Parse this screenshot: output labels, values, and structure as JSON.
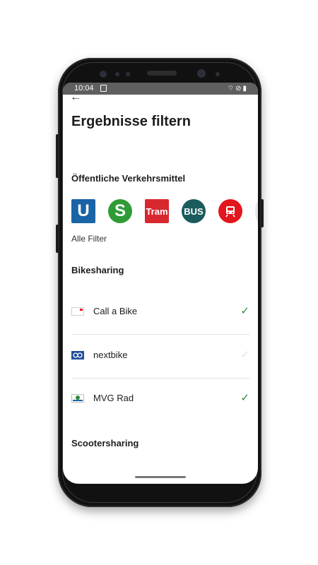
{
  "status": {
    "time": "10:04"
  },
  "page": {
    "title": "Ergebnisse filtern",
    "back_label": "←"
  },
  "transit": {
    "heading": "Öffentliche Verkehrsmittel",
    "items": [
      {
        "icon": "ubahn-icon",
        "label": "U"
      },
      {
        "icon": "sbahn-icon",
        "label": "S"
      },
      {
        "icon": "tram-icon",
        "label": "Tram"
      },
      {
        "icon": "bus-icon",
        "label": "BUS"
      },
      {
        "icon": "train-icon",
        "label": ""
      }
    ],
    "all_filters": "Alle Filter"
  },
  "bikesharing": {
    "heading": "Bikesharing",
    "items": [
      {
        "label": "Call a Bike",
        "checked": true,
        "check": "✓"
      },
      {
        "label": "nextbike",
        "checked": false,
        "check": "✓"
      },
      {
        "label": "MVG Rad",
        "checked": true,
        "check": "✓"
      }
    ]
  },
  "scootersharing": {
    "heading": "Scootersharing"
  },
  "colors": {
    "accent": "#2e8b3a",
    "inactive_check": "#e3e3e3"
  }
}
